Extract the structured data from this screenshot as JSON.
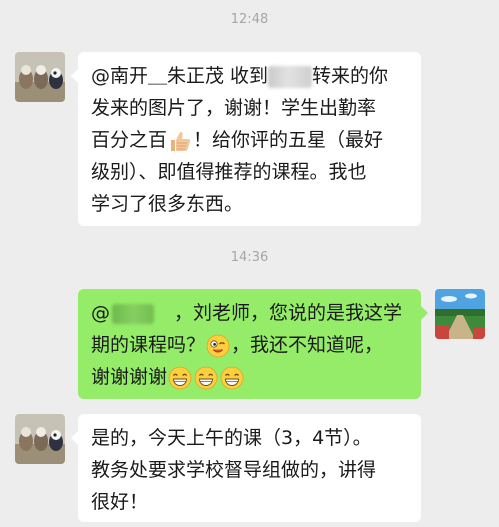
{
  "chat": {
    "timestamps": [
      "12:48",
      "14:36"
    ],
    "messages": [
      {
        "sender": "other",
        "lines": [
          {
            "a": "@南开＿朱正茂  收到",
            "b": "转来的你"
          },
          {
            "a": "发来的图片了，谢谢！学生出勤率"
          },
          {
            "a": "百分之百",
            "b": "！给你评的五星（最好"
          },
          {
            "a": "级别）、即值得推荐的课程。我也"
          },
          {
            "a": "学习了很多东西。"
          }
        ],
        "emoji": [
          "thumbs-up"
        ]
      },
      {
        "sender": "me",
        "lines": [
          {
            "a": "@",
            "b": "，刘老师，您说的是我这学"
          },
          {
            "a": "期的课程吗？",
            "b": "，我还不知道呢，"
          },
          {
            "a": "谢谢谢谢"
          }
        ],
        "emoji": [
          "winking-face",
          "grinning-face",
          "grinning-face",
          "grinning-face"
        ]
      },
      {
        "sender": "other",
        "lines": [
          {
            "a": "是的，今天上午的课（3，4节）。"
          },
          {
            "a": "教务处要求学校督导组做的，讲得"
          },
          {
            "a": "很好！"
          }
        ]
      }
    ]
  },
  "colors": {
    "background": "#ededed",
    "incoming_bubble": "#ffffff",
    "outgoing_bubble": "#95ec69",
    "timestamp_text": "#a6a6a6"
  }
}
